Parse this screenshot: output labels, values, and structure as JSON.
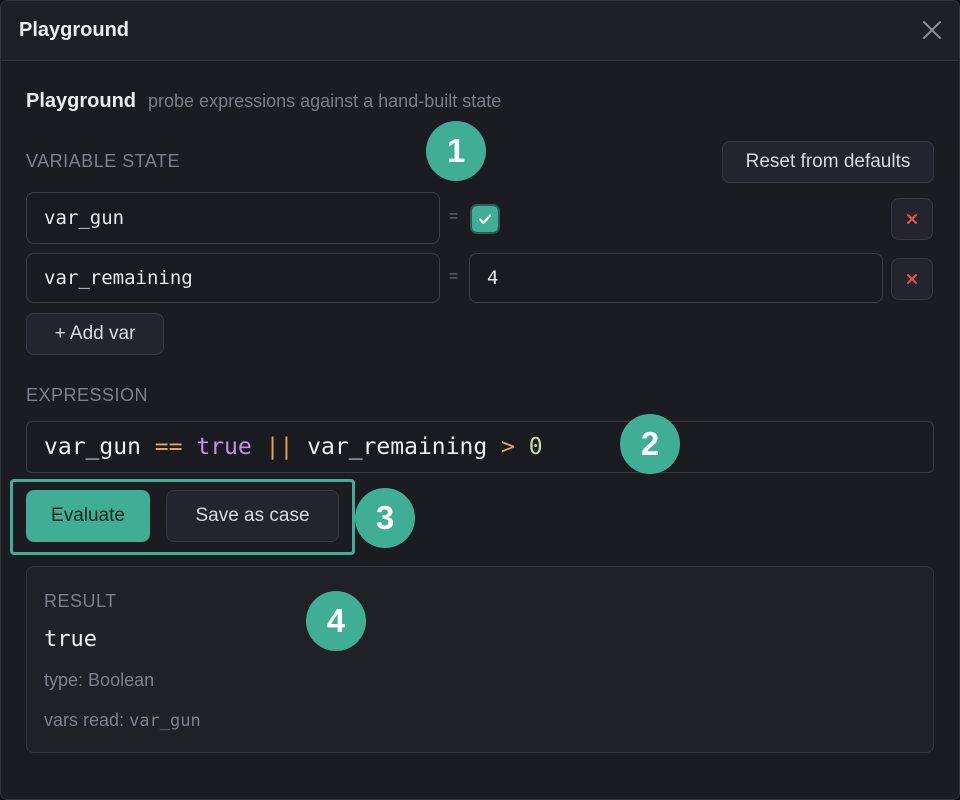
{
  "window": {
    "title": "Playground"
  },
  "heading": {
    "title": "Playground",
    "subtitle": "probe expressions against a hand-built state"
  },
  "variable_state": {
    "label": "VARIABLE STATE",
    "reset_label": "Reset from defaults",
    "equals": "=",
    "rows": [
      {
        "name": "var_gun",
        "value_type": "boolean",
        "value": true
      },
      {
        "name": "var_remaining",
        "value_type": "number",
        "value": "4"
      }
    ],
    "add_label": "+ Add var"
  },
  "expression": {
    "label": "EXPRESSION",
    "tokens": [
      {
        "text": "var_gun",
        "kind": "ident"
      },
      {
        "text": " ",
        "kind": "space"
      },
      {
        "text": "==",
        "kind": "op"
      },
      {
        "text": " ",
        "kind": "space"
      },
      {
        "text": "true",
        "kind": "kw"
      },
      {
        "text": " ",
        "kind": "space"
      },
      {
        "text": "||",
        "kind": "op"
      },
      {
        "text": " ",
        "kind": "space"
      },
      {
        "text": "var_remaining",
        "kind": "ident"
      },
      {
        "text": " ",
        "kind": "space"
      },
      {
        "text": ">",
        "kind": "op"
      },
      {
        "text": " ",
        "kind": "space"
      },
      {
        "text": "0",
        "kind": "num"
      }
    ]
  },
  "actions": {
    "evaluate_label": "Evaluate",
    "save_label": "Save as case"
  },
  "result": {
    "label": "RESULT",
    "value": "true",
    "type_prefix": "type:",
    "type_value": "Boolean",
    "vars_prefix": "vars read:",
    "vars_value": "var_gun"
  },
  "markers": [
    "1",
    "2",
    "3",
    "4"
  ],
  "icons": {
    "close": "close-icon",
    "remove": "remove-icon",
    "check": "check-icon"
  },
  "colors": {
    "accent": "#3fae94",
    "remove": "#e0525c",
    "op": "#e0a45c",
    "keyword": "#c48fe6",
    "number": "#c7d8a3"
  }
}
